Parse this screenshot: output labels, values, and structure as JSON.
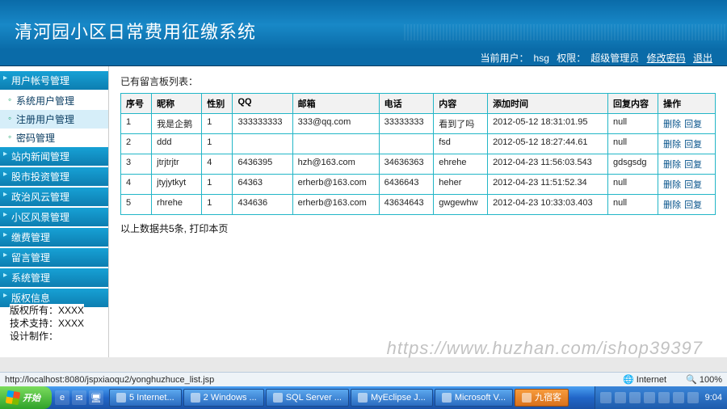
{
  "header": {
    "title": "清河园小区日常费用征缴系统"
  },
  "userbar": {
    "cur_user_label": "当前用户：",
    "cur_user": "hsg",
    "role_label": "权限：",
    "role": "超级管理员",
    "changepwd": "修改密码",
    "logout": "退出"
  },
  "sidebar": {
    "categories": [
      {
        "label": "用户帐号管理",
        "subs": [
          {
            "label": "系统用户管理"
          },
          {
            "label": "注册用户管理",
            "active": true
          },
          {
            "label": "密码管理"
          }
        ]
      },
      {
        "label": "站内新闻管理"
      },
      {
        "label": "股市投资管理"
      },
      {
        "label": "政治风云管理"
      },
      {
        "label": "小区风景管理"
      },
      {
        "label": "缴费管理"
      },
      {
        "label": "留言管理"
      },
      {
        "label": "系统管理"
      },
      {
        "label": "版权信息"
      }
    ]
  },
  "copyright": {
    "line1": "版权所有：XXXX",
    "line2": "技术支持：XXXX",
    "line3": "设计制作："
  },
  "main": {
    "list_title": "已有留言板列表：",
    "columns": [
      "序号",
      "昵称",
      "性别",
      "QQ",
      "邮箱",
      "电话",
      "内容",
      "添加时间",
      "回复内容",
      "操作"
    ],
    "rows": [
      {
        "idx": "1",
        "nick": "我是企鹅",
        "sex": "1",
        "qq": "333333333",
        "mail": "333@qq.com",
        "tel": "33333333",
        "content": "看到了吗",
        "time": "2012-05-12 18:31:01.95",
        "reply": "null"
      },
      {
        "idx": "2",
        "nick": "ddd",
        "sex": "1",
        "qq": "",
        "mail": "",
        "tel": "",
        "content": "fsd",
        "time": "2012-05-12 18:27:44.61",
        "reply": "null"
      },
      {
        "idx": "3",
        "nick": "jtrjtrjtr",
        "sex": "4",
        "qq": "6436395",
        "mail": "hzh@163.com",
        "tel": "34636363",
        "content": "ehrehe",
        "time": "2012-04-23 11:56:03.543",
        "reply": "gdsgsdg"
      },
      {
        "idx": "4",
        "nick": "jtyjytkyt",
        "sex": "1",
        "qq": "64363",
        "mail": "erherb@163.com",
        "tel": "6436643",
        "content": "heher",
        "time": "2012-04-23 11:51:52.34",
        "reply": "null"
      },
      {
        "idx": "5",
        "nick": "rhrehe",
        "sex": "1",
        "qq": "434636",
        "mail": "erherb@163.com",
        "tel": "43634643",
        "content": "gwgewhw",
        "time": "2012-04-23 10:33:03.403",
        "reply": "null"
      }
    ],
    "op_delete": "删除",
    "op_reply": "回复",
    "summary": "以上数据共5条, 打印本页"
  },
  "watermark": "https://www.huzhan.com/ishop39397",
  "addressbar": {
    "url": "http://localhost:8080/jspxiaoqu2/yonghuzhuce_list.jsp",
    "internet": "Internet",
    "zoom": "100%"
  },
  "taskbar": {
    "start": "开始",
    "tasks": [
      {
        "label": "5 Internet..."
      },
      {
        "label": "2 Windows ..."
      },
      {
        "label": "SQL Server ..."
      },
      {
        "label": "MyEclipse J..."
      },
      {
        "label": "Microsoft V..."
      },
      {
        "label": "九宿客",
        "orange": true
      }
    ],
    "clock": "9:04"
  }
}
